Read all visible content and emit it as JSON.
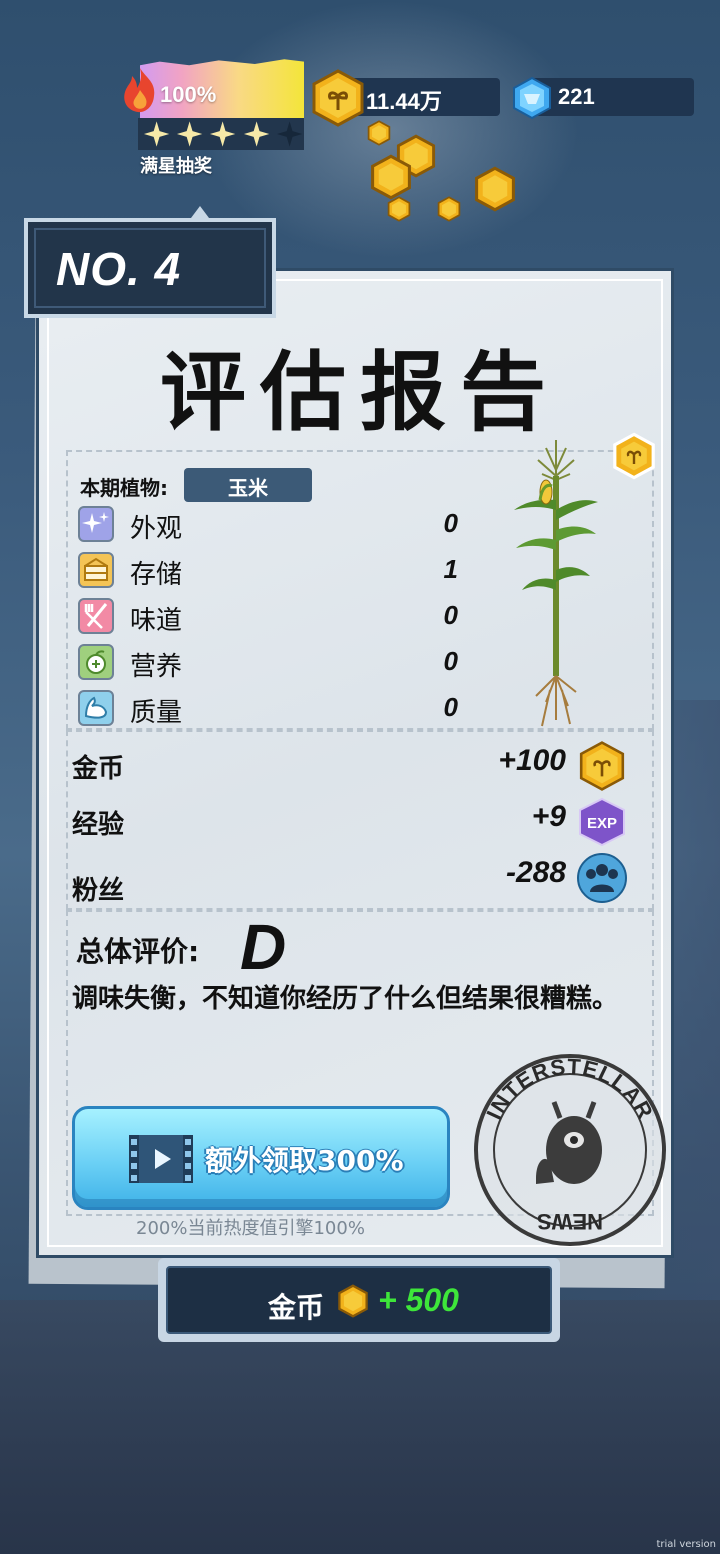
{
  "hud": {
    "heat_percent": "100%",
    "stars_filled": 4,
    "stars_total": 5,
    "full_star_label": "满星抽奖",
    "coins": "11.44万",
    "gems": "221"
  },
  "report": {
    "number": "NO. 4",
    "title": "评估报告",
    "plant_label": "本期植物:",
    "plant_name": "玉米",
    "attributes": [
      {
        "label": "外观",
        "value": "0",
        "icon": "sparkle-icon",
        "color": "#9fa3e8"
      },
      {
        "label": "存储",
        "value": "1",
        "icon": "storage-icon",
        "color": "#f4c456"
      },
      {
        "label": "味道",
        "value": "0",
        "icon": "utensils-icon",
        "color": "#f28aa5"
      },
      {
        "label": "营养",
        "value": "0",
        "icon": "nutrition-icon",
        "color": "#9fd07e"
      },
      {
        "label": "质量",
        "value": "0",
        "icon": "muscle-icon",
        "color": "#8fd0ec"
      }
    ],
    "rewards": {
      "coin_label": "金币",
      "coin_value": "+100",
      "exp_label": "经验",
      "exp_value": "+9",
      "exp_badge": "EXP",
      "fans_label": "粉丝",
      "fans_value": "-288"
    },
    "overall_label": "总体评价:",
    "grade": "D",
    "comment": "调味失衡，不知道你经历了什么但结果很糟糕。",
    "video_button": "额外领取300%",
    "hint": "200%当前热度值引擎100%",
    "stamp_top": "INTERSTELLAR",
    "stamp_bottom": "NEWS"
  },
  "claim": {
    "label": "金币",
    "value": "+ 500"
  },
  "watermark": "trial version",
  "colors": {
    "accent_green": "#3ee63a",
    "panel_dark": "#1d2f44",
    "button_blue": "#6bd0f5",
    "coin_gold": "#f2b21b"
  }
}
